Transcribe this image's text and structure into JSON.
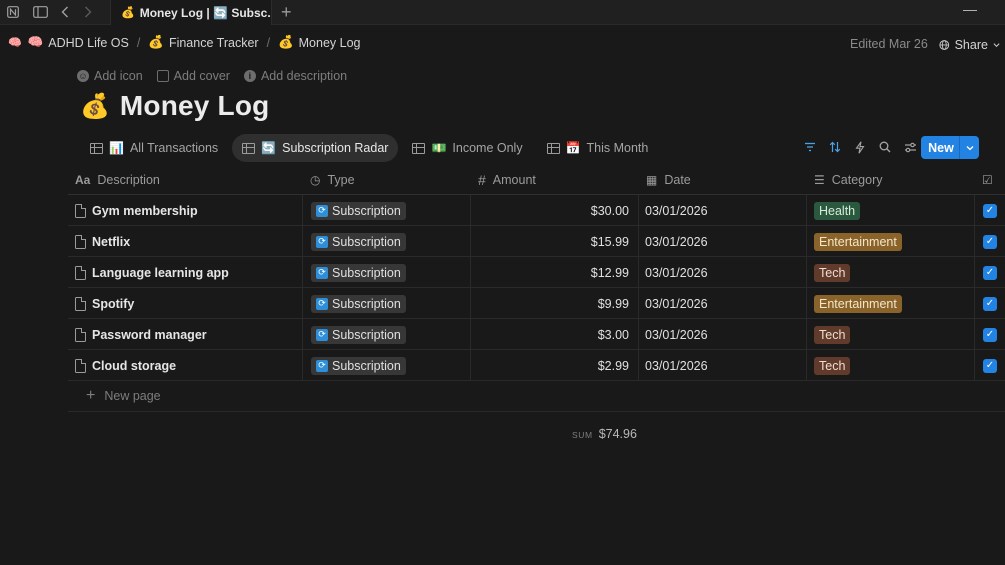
{
  "titlebar": {
    "tab_title": "Money Log | 🔄 Subsc...",
    "tab_emoji": "💰"
  },
  "breadcrumb": [
    {
      "emoji": "🧠",
      "label": "ADHD Life OS"
    },
    {
      "emoji": "💰",
      "label": "Finance Tracker"
    },
    {
      "emoji": "💰",
      "label": "Money Log"
    }
  ],
  "header": {
    "edited": "Edited Mar 26",
    "share_label": "Share"
  },
  "page_actions": {
    "add_icon": "Add icon",
    "add_cover": "Add cover",
    "add_description": "Add description"
  },
  "page": {
    "emoji": "💰",
    "title": "Money Log"
  },
  "views": [
    {
      "emoji": "📊",
      "label": "All Transactions",
      "active": false
    },
    {
      "emoji": "🔄",
      "label": "Subscription Radar",
      "active": true
    },
    {
      "emoji": "💵",
      "label": "Income Only",
      "active": false
    },
    {
      "emoji": "📅",
      "label": "This Month",
      "active": false
    }
  ],
  "toolbar": {
    "new_label": "New"
  },
  "table": {
    "columns": [
      {
        "icon": "Aa",
        "label": "Description"
      },
      {
        "icon": "◷",
        "label": "Type"
      },
      {
        "icon": "#",
        "label": "Amount"
      },
      {
        "icon": "▦",
        "label": "Date"
      },
      {
        "icon": "☰",
        "label": "Category"
      },
      {
        "icon": "☑",
        "label": ""
      }
    ],
    "rows": [
      {
        "description": "Gym membership",
        "type": "Subscription",
        "amount": "$30.00",
        "date": "03/01/2026",
        "category": "Health",
        "checked": true
      },
      {
        "description": "Netflix",
        "type": "Subscription",
        "amount": "$15.99",
        "date": "03/01/2026",
        "category": "Entertainment",
        "checked": true
      },
      {
        "description": "Language learning app",
        "type": "Subscription",
        "amount": "$12.99",
        "date": "03/01/2026",
        "category": "Tech",
        "checked": true
      },
      {
        "description": "Spotify",
        "type": "Subscription",
        "amount": "$9.99",
        "date": "03/01/2026",
        "category": "Entertainment",
        "checked": true
      },
      {
        "description": "Password manager",
        "type": "Subscription",
        "amount": "$3.00",
        "date": "03/01/2026",
        "category": "Tech",
        "checked": true
      },
      {
        "description": "Cloud storage",
        "type": "Subscription",
        "amount": "$2.99",
        "date": "03/01/2026",
        "category": "Tech",
        "checked": true
      }
    ],
    "new_page_label": "New page",
    "sum_label": "SUM",
    "sum_value": "$74.96"
  },
  "colors": {
    "category": {
      "Health": {
        "bg": "#2b593f",
        "fg": "#d6ebd9"
      },
      "Entertainment": {
        "bg": "#89632a",
        "fg": "#f5e6c8"
      },
      "Tech": {
        "bg": "#603b2c",
        "fg": "#f0dbd1"
      }
    },
    "accent": "#2383e2"
  }
}
